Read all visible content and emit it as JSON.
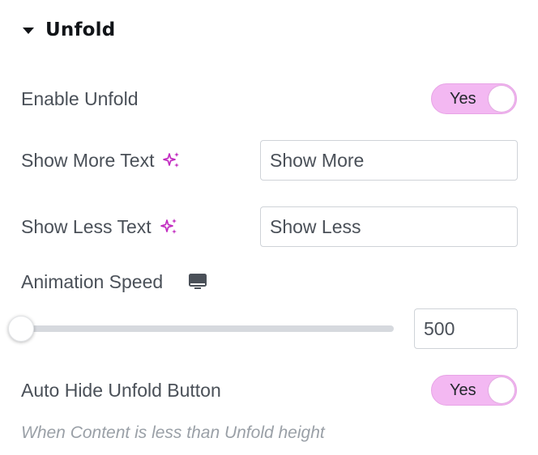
{
  "section": {
    "title": "Unfold"
  },
  "enable_unfold": {
    "label": "Enable Unfold",
    "toggle_label": "Yes",
    "checked": true
  },
  "show_more": {
    "label": "Show More Text",
    "value": "Show More",
    "icon": "ai-sparkle-icon"
  },
  "show_less": {
    "label": "Show Less Text",
    "value": "Show Less",
    "icon": "ai-sparkle-icon"
  },
  "animation_speed": {
    "label": "Animation Speed",
    "device_icon": "desktop-icon",
    "value": "500",
    "slider_fraction": 0
  },
  "auto_hide": {
    "label": "Auto Hide Unfold Button",
    "toggle_label": "Yes",
    "checked": true,
    "description": "When Content is less than Unfold height"
  },
  "colors": {
    "accent": "#f3b8f2",
    "sparkle": "#c22cc0"
  }
}
